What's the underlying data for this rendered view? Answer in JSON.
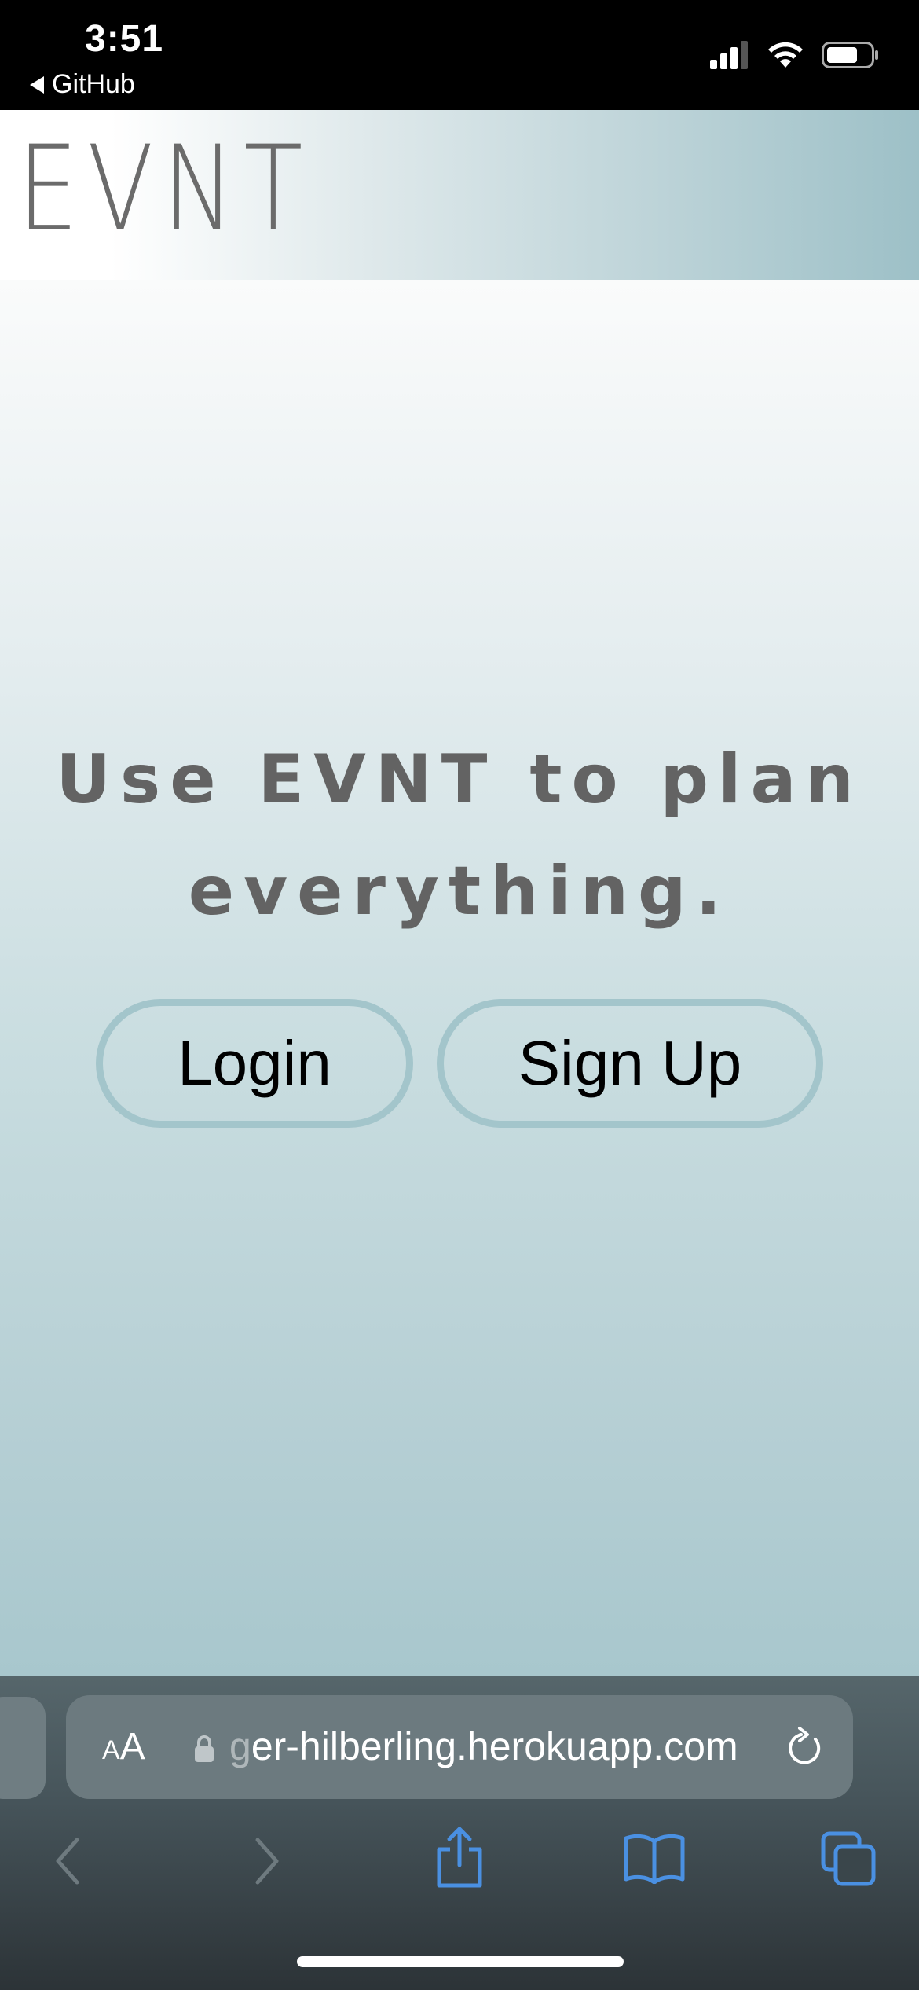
{
  "status_bar": {
    "time": "3:51",
    "back_app": "GitHub",
    "icons": [
      "cellular-signal-icon",
      "wifi-icon",
      "battery-icon"
    ]
  },
  "header": {
    "logo_text": "EVNT"
  },
  "hero": {
    "tagline_line1": "Use EVNT to plan",
    "tagline_line2": "everything.",
    "login_label": "Login",
    "signup_label": "Sign Up"
  },
  "browser": {
    "text_size_small": "A",
    "text_size_big": "A",
    "url_fade": "g",
    "url": "er-hilberling.herokuapp.com",
    "toolbar_icons": [
      "back-arrow-icon",
      "forward-arrow-icon",
      "share-icon",
      "bookmarks-icon",
      "tabs-icon"
    ]
  },
  "colors": {
    "button_border": "#a3c5cb",
    "tagline": "#636363",
    "safari_blue": "#4a90e2"
  }
}
